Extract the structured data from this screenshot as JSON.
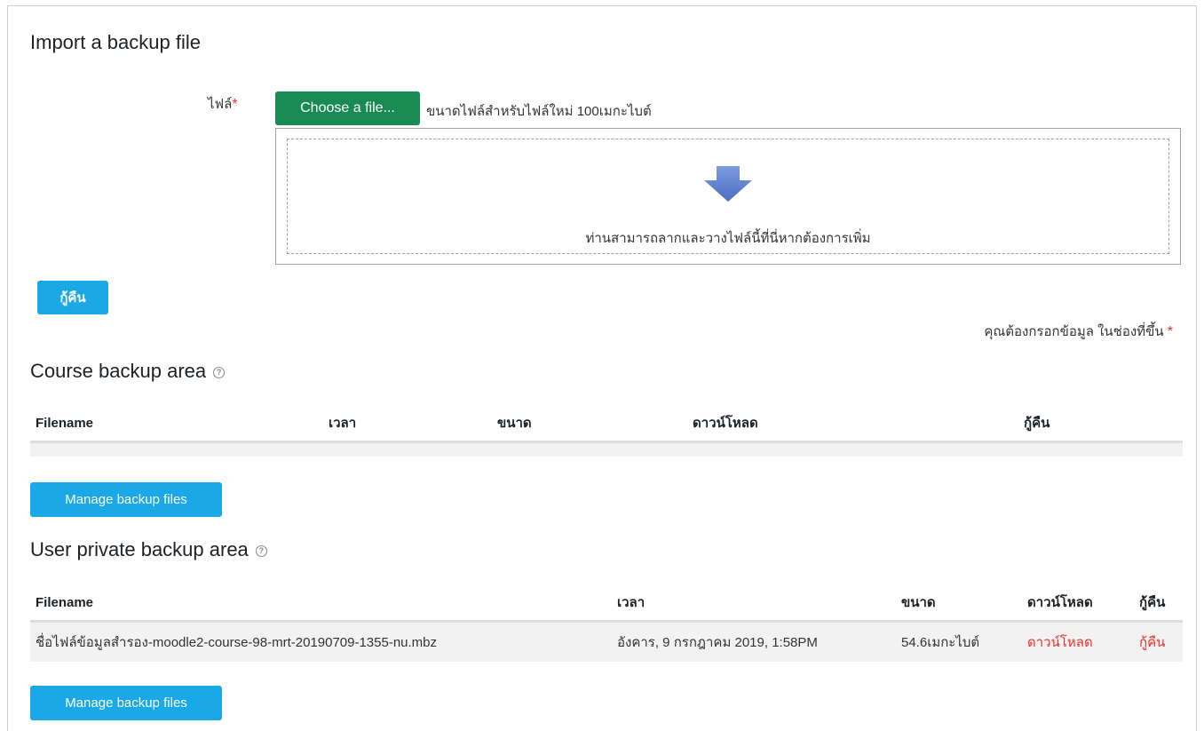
{
  "import": {
    "title": "Import a backup file",
    "file_label": "ไฟล์",
    "required_mark": "*",
    "choose_button": "Choose a file...",
    "max_size_text": "ขนาดไฟล์สำหรับไฟล์ใหม่ 100เมกะไบต์",
    "drop_text": "ท่านสามารถลากและวางไฟล์นี้ที่นี่หากต้องการเพิ่ม",
    "restore_button": "กู้คืน",
    "required_note": "คุณต้องกรอกข้อมูล ในช่องที่ขึ้น"
  },
  "course_backup": {
    "title": "Course backup area",
    "help_icon": "?",
    "columns": [
      "Filename",
      "เวลา",
      "ขนาด",
      "ดาวน์โหลด",
      "กู้คืน"
    ],
    "rows": [],
    "manage_button": "Manage backup files"
  },
  "user_backup": {
    "title": "User private backup area",
    "help_icon": "?",
    "columns": [
      "Filename",
      "เวลา",
      "ขนาด",
      "ดาวน์โหลด",
      "กู้คืน"
    ],
    "rows": [
      {
        "filename": "ชื่อไฟล์ข้อมูลสำรอง-moodle2-course-98-mrt-20190709-1355-nu.mbz",
        "time": "อังคาร, 9 กรกฎาคม 2019, 1:58PM",
        "size": "54.6เมกะไบต์",
        "download": "ดาวน์โหลด",
        "restore": "กู้คืน"
      }
    ],
    "manage_button": "Manage backup files"
  },
  "colors": {
    "green_button": "#1a8a54",
    "blue_button": "#1aa9e6",
    "required_red": "#e5332a",
    "arrow_blue": "#5b7fc9"
  }
}
